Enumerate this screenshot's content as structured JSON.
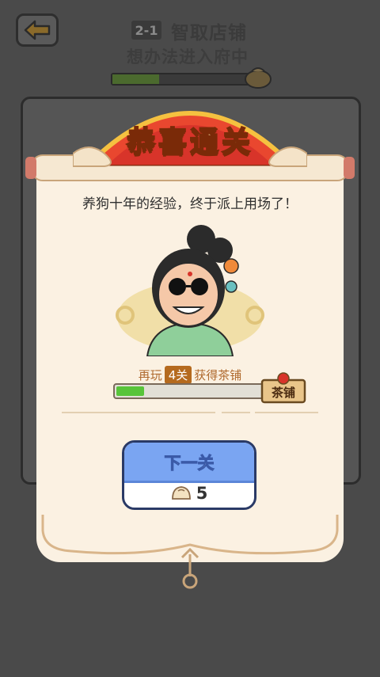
{
  "header": {
    "level_number": "2-1",
    "level_title": "智取店铺",
    "level_subtitle": "想办法进入府中",
    "progress": 0.3
  },
  "popup": {
    "title": "恭喜通关",
    "message": "养狗十年的经验，终于派上用场了！",
    "unlock": {
      "prefix": "再玩",
      "count": "4关",
      "suffix": "获得茶铺",
      "progress": 0.2,
      "reward_name": "茶铺"
    },
    "next_button": {
      "label": "下一关",
      "cost": "5",
      "cost_icon": "bun-icon"
    }
  },
  "colors": {
    "banner_red": "#d8342a",
    "scroll_paper": "#fbf1e2",
    "button_blue": "#7aa5f2",
    "progress_green": "#58c43a"
  }
}
